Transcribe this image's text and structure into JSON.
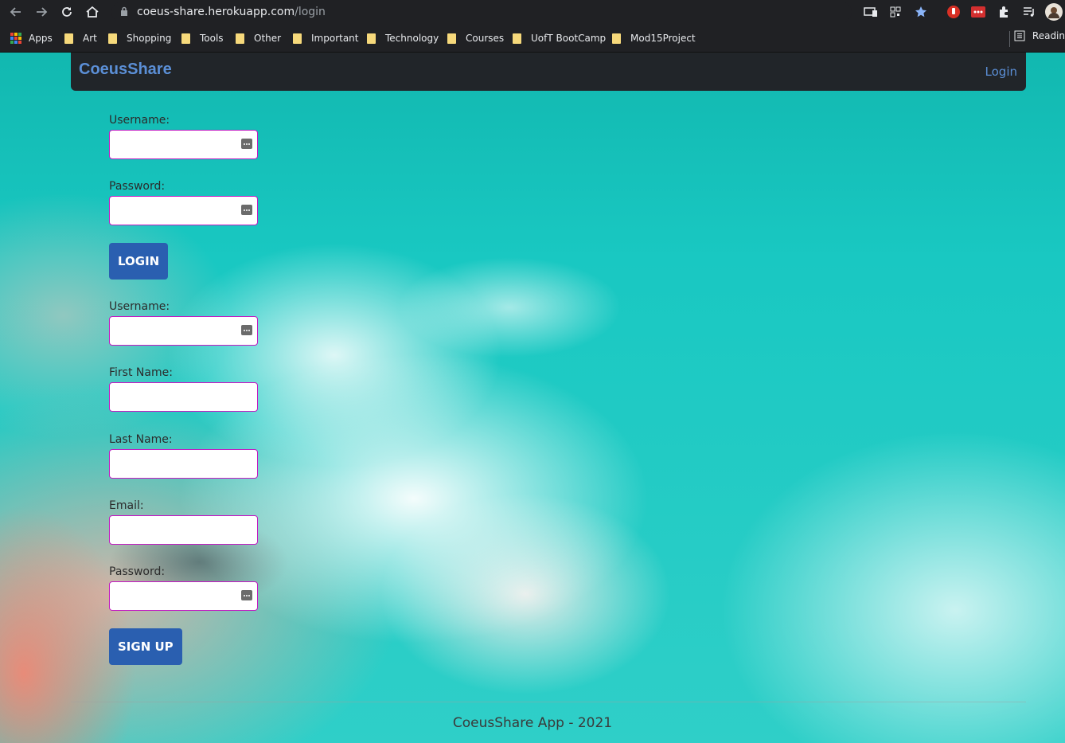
{
  "browser": {
    "url_host": "coeus-share.herokuapp.com",
    "url_path": "/login",
    "bookmarks": [
      "Apps",
      "Art",
      "Shopping",
      "Tools",
      "Other",
      "Important",
      "Technology",
      "Courses",
      "UofT BootCamp",
      "Mod15Project"
    ],
    "reading_list": "Readin"
  },
  "navbar": {
    "brand": "CoeusShare",
    "login_link": "Login"
  },
  "login_form": {
    "username_label": "Username:",
    "password_label": "Password:",
    "submit_label": "LOGIN"
  },
  "signup_form": {
    "username_label": "Username:",
    "first_name_label": "First Name:",
    "last_name_label": "Last Name:",
    "email_label": "Email:",
    "password_label": "Password:",
    "submit_label": "SIGN UP"
  },
  "footer": {
    "text": "CoeusShare App - 2021"
  },
  "colors": {
    "accent": "#5b8fd6",
    "button": "#2a5fb0",
    "input_border": "#c21ac2",
    "navbar": "#212529"
  }
}
